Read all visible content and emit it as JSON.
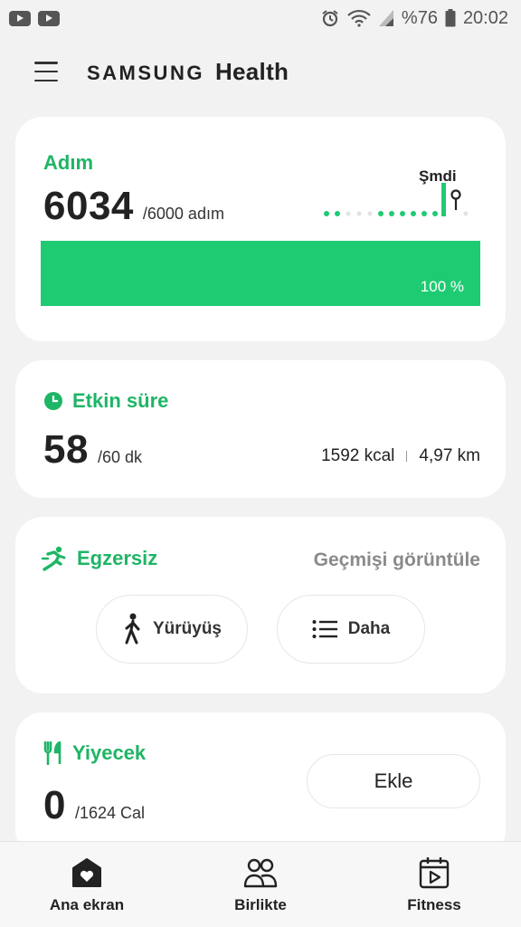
{
  "status_bar": {
    "battery_text": "%76",
    "time": "20:02",
    "icons": [
      "youtube-icon",
      "youtube-icon",
      "alarm-icon",
      "wifi-icon",
      "signal-icon",
      "battery-icon"
    ]
  },
  "header": {
    "brand_samsung": "SAMSUNG",
    "brand_health": "Health",
    "menu_icon": "hamburger-menu-icon"
  },
  "steps": {
    "title": "Adım",
    "value": "6034",
    "goal": "/6000 adım",
    "progress_percent": 100,
    "progress_label": "100 %",
    "now_label": "Şmdi",
    "accent_color": "#1fcb72"
  },
  "active_time": {
    "title": "Etkin süre",
    "value": "58",
    "goal": "/60 dk",
    "calories": "1592 kcal",
    "distance": "4,97 km",
    "icon": "clock-icon"
  },
  "exercise": {
    "title": "Egzersiz",
    "history_link": "Geçmişi görüntüle",
    "walk_label": "Yürüyüş",
    "more_label": "Daha",
    "icon": "running-icon"
  },
  "food": {
    "title": "Yiyecek",
    "value": "0",
    "goal": "/1624 Cal",
    "add_label": "Ekle",
    "icon": "fork-knife-icon"
  },
  "bottom_nav": {
    "items": [
      {
        "label": "Ana ekran",
        "icon": "home-heart-icon"
      },
      {
        "label": "Birlikte",
        "icon": "people-icon"
      },
      {
        "label": "Fitness",
        "icon": "calendar-play-icon"
      }
    ]
  }
}
